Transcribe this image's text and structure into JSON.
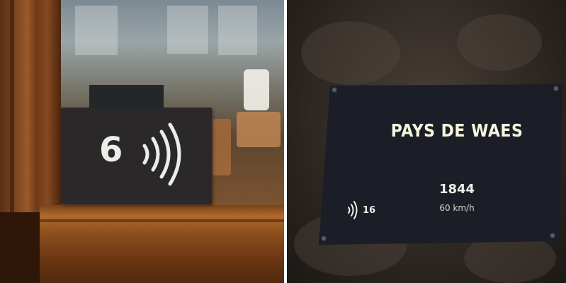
{
  "left_photo": {
    "sign": {
      "number": "6",
      "icon": "audio-waves-icon"
    }
  },
  "right_photo": {
    "plaque": {
      "title": "PAYS DE WAES",
      "year": "1844",
      "speed": "60 km/h",
      "audio_number": "16",
      "audio_icon": "audio-waves-icon"
    }
  }
}
